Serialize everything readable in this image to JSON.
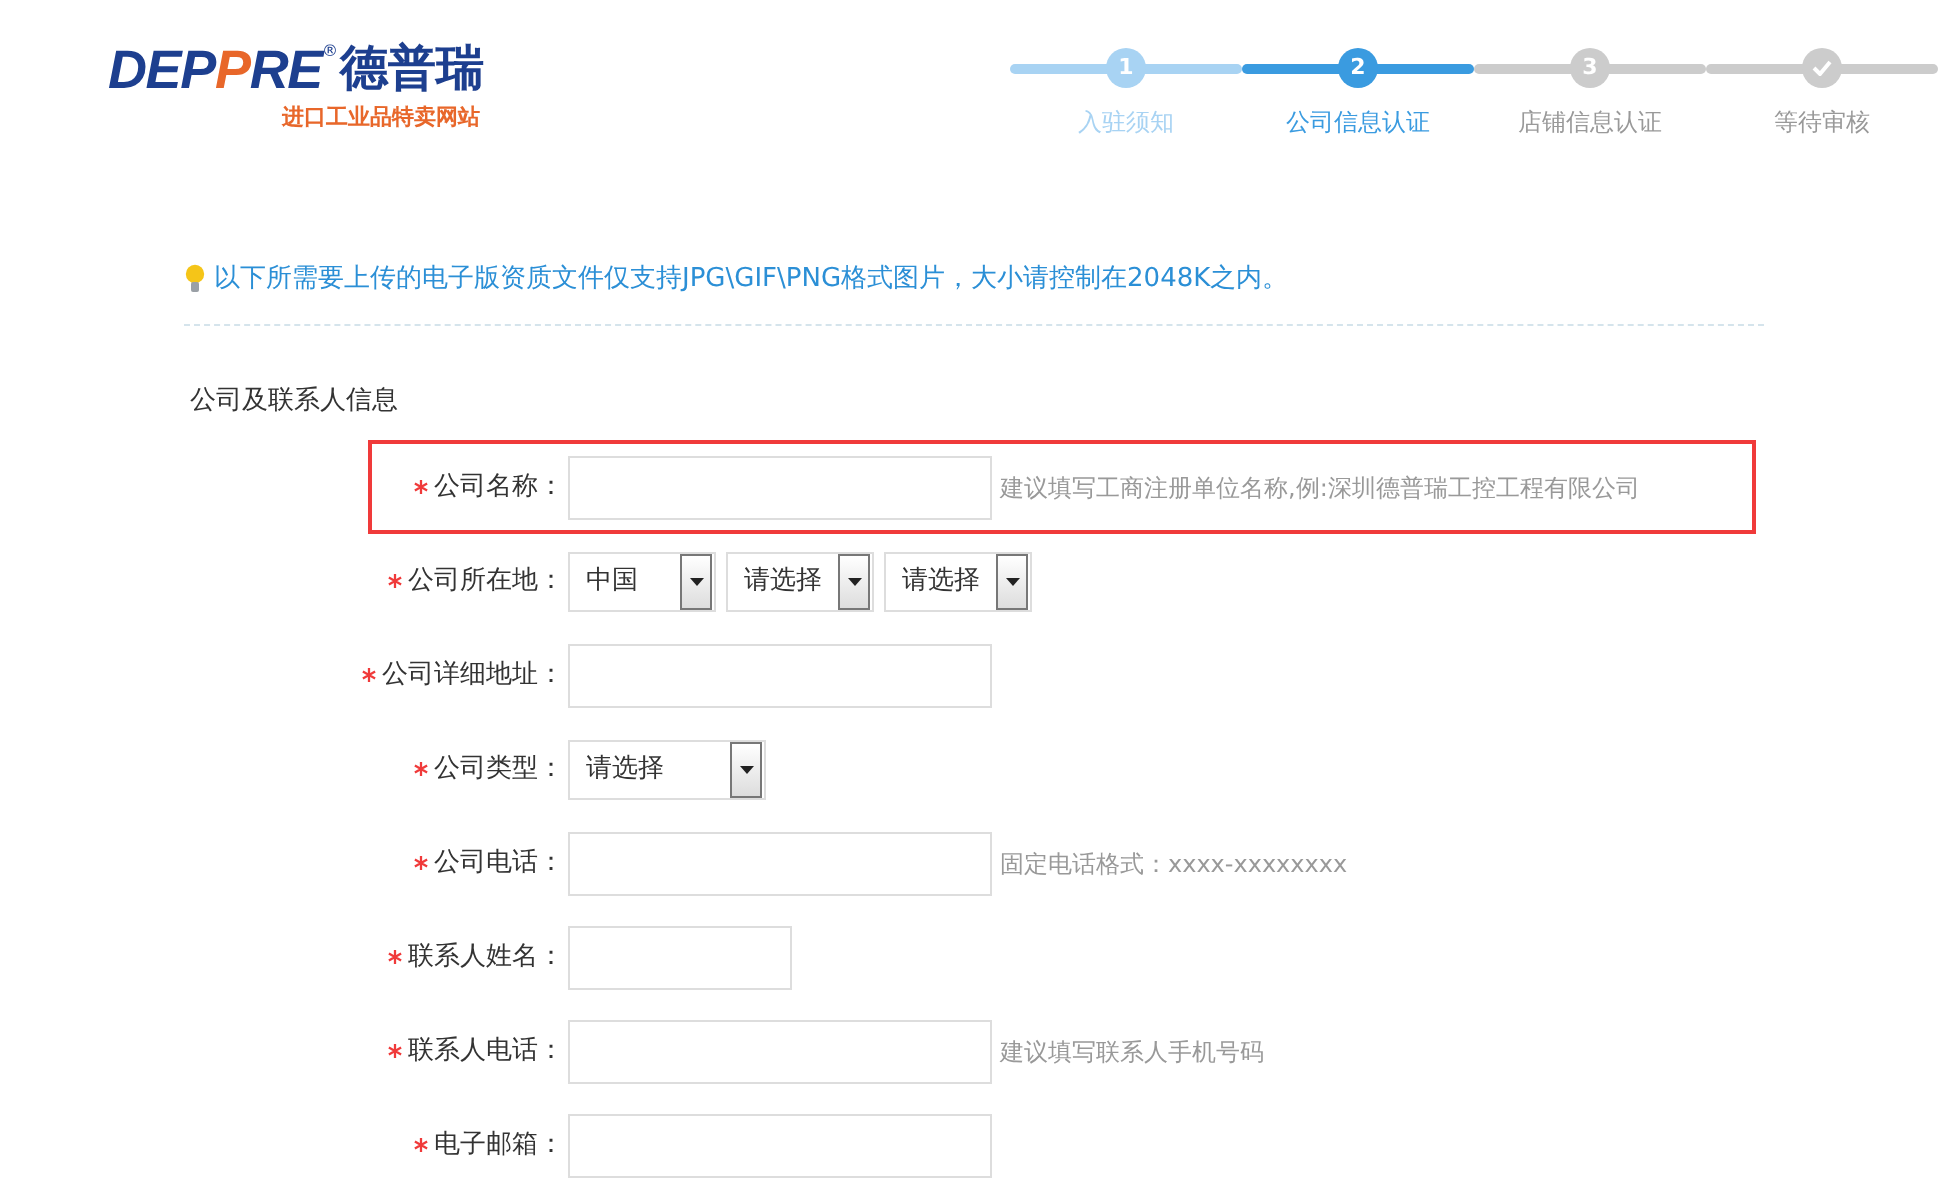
{
  "logo": {
    "wordmark_parts": [
      {
        "text": "DEP",
        "accent": false
      },
      {
        "text": "P",
        "accent": true
      },
      {
        "text": "RE",
        "accent": false
      }
    ],
    "registered": "®",
    "name": "德普瑞",
    "tagline": "进口工业品特卖网站"
  },
  "steps": [
    {
      "number": "1",
      "label": "入驻须知",
      "completed": true,
      "selected": false
    },
    {
      "number": "2",
      "label": "公司信息认证",
      "completed": false,
      "selected": true
    },
    {
      "number": "3",
      "label": "店铺信息认证",
      "completed": false,
      "selected": false
    },
    {
      "label": "等待审核",
      "completed": false,
      "selected": false
    }
  ],
  "notice": "以下所需要上传的电子版资质文件仅支持JPG\\GIF\\PNG格式图片，大小请控制在2048K之内。",
  "section_title": "公司及联系人信息",
  "fields": [
    {
      "label": "公司名称：",
      "required": true,
      "kind": "input",
      "narrow": false,
      "hint": "建议填写工商注册单位名称,例:深圳德普瑞工控工程有限公司",
      "highlighted": true
    },
    {
      "label": "公司所在地：",
      "required": true,
      "kind": "selects",
      "selects": [
        "中国",
        "请选择",
        "请选择"
      ],
      "highlighted": false
    },
    {
      "label": "公司详细地址：",
      "required": true,
      "kind": "input",
      "narrow": false,
      "highlighted": false
    },
    {
      "label": "公司类型：",
      "required": true,
      "kind": "selects",
      "selects": [
        "请选择"
      ],
      "highlighted": false
    },
    {
      "label": "公司电话：",
      "required": true,
      "kind": "input",
      "narrow": false,
      "hint": "固定电话格式：xxxx-xxxxxxxx",
      "highlighted": false
    },
    {
      "label": "联系人姓名：",
      "required": true,
      "kind": "input",
      "narrow": true,
      "highlighted": false
    },
    {
      "label": "联系人电话：",
      "required": true,
      "kind": "input",
      "narrow": false,
      "hint": "建议填写联系人手机号码",
      "highlighted": false
    },
    {
      "label": "电子邮箱：",
      "required": true,
      "kind": "input",
      "narrow": false,
      "highlighted": false
    }
  ]
}
